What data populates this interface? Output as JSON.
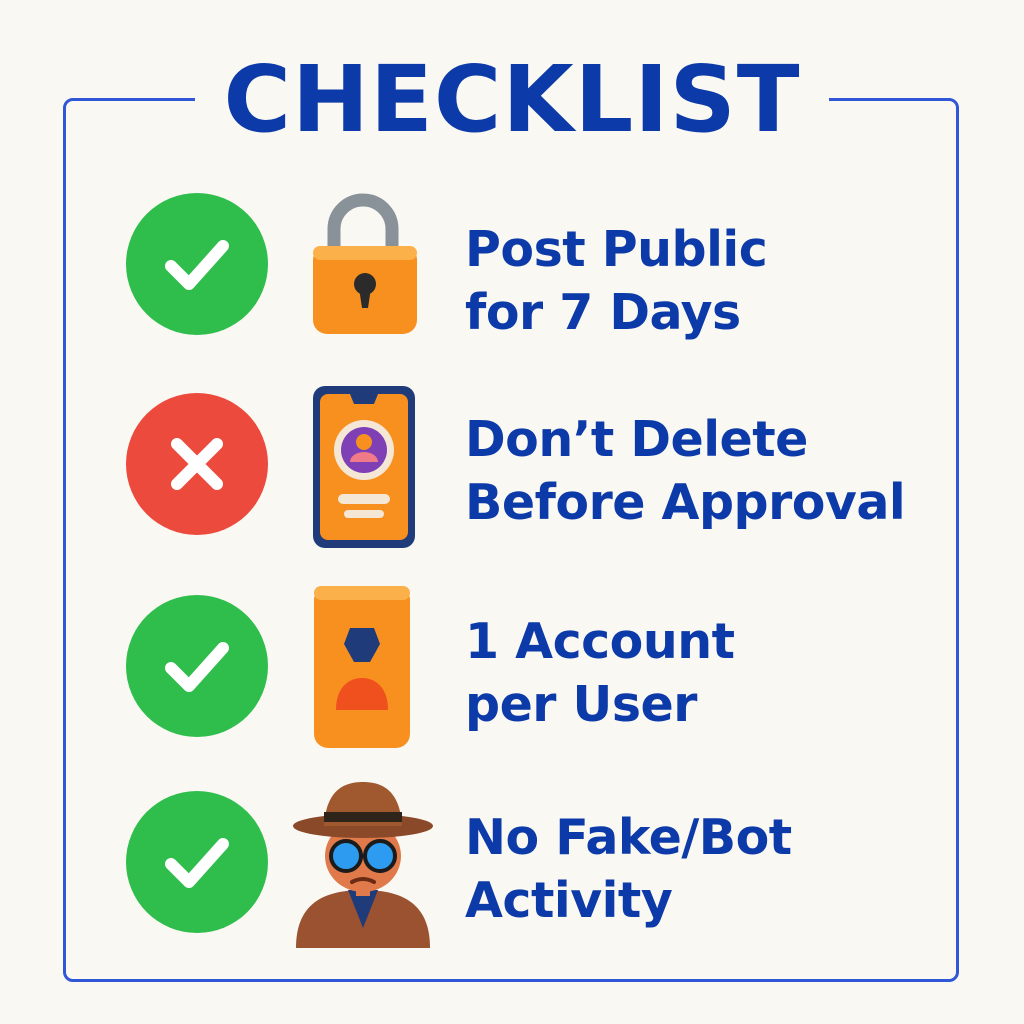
{
  "title": "CHECKLIST",
  "colors": {
    "accent": "#0c3aa8",
    "frame": "#2f57d6",
    "ok": "#2fbe4c",
    "no": "#ec4a3c",
    "icon_orange": "#f7901e"
  },
  "items": [
    {
      "status": "check",
      "icon": "padlock-icon",
      "line1": "Post Public",
      "line2": "for 7 Days"
    },
    {
      "status": "cross",
      "icon": "smartphone-profile-icon",
      "line1": "Don’t Delete",
      "line2": "Before Approval"
    },
    {
      "status": "check",
      "icon": "user-id-card-icon",
      "line1": "1 Account",
      "line2": "per User"
    },
    {
      "status": "check",
      "icon": "detective-icon",
      "line1": "No Fake/Bot",
      "line2": "Activity"
    }
  ]
}
